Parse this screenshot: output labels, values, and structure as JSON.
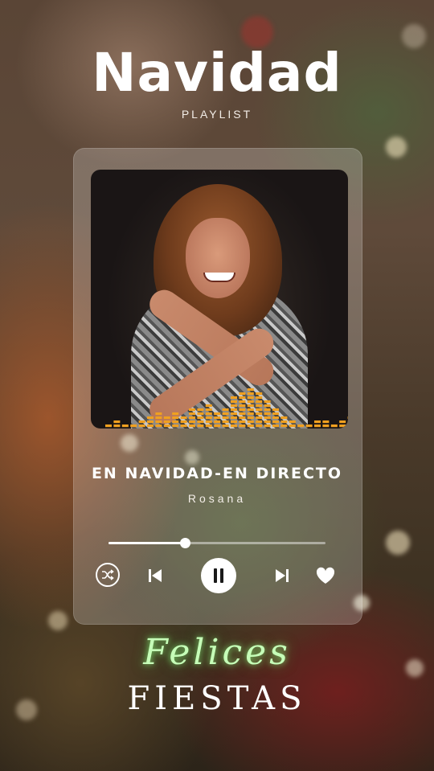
{
  "header": {
    "title": "Navidad",
    "subtitle": "PLAYLIST"
  },
  "player": {
    "song_title": "EN NAVIDAD-EN DIRECTO",
    "artist": "Rosana",
    "progress": 0.35,
    "accent_color": "#f0a020",
    "controls": {
      "shuffle_icon": "shuffle-icon",
      "prev_icon": "skip-previous-icon",
      "play_state": "playing",
      "pause_icon": "pause-icon",
      "next_icon": "skip-next-icon",
      "like_icon": "heart-icon"
    }
  },
  "footer": {
    "line1": "Felices",
    "line2": "FIESTAS"
  }
}
